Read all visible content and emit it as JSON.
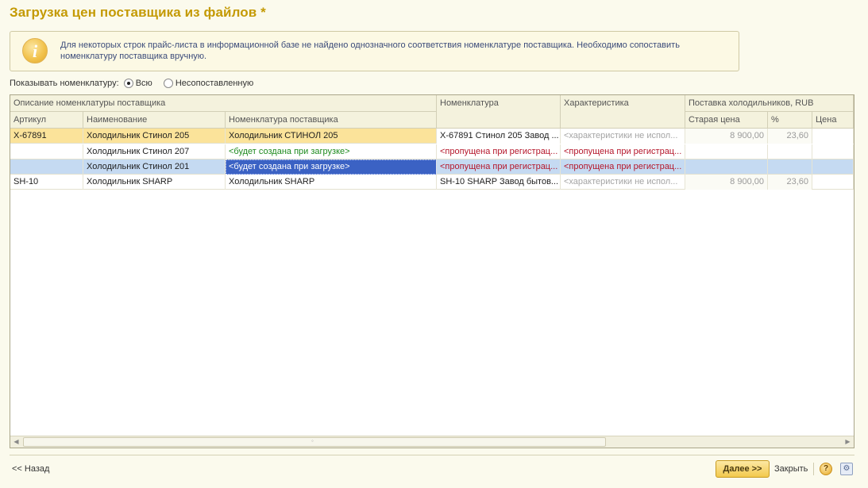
{
  "window": {
    "title": "Загрузка цен поставщика из файлов *"
  },
  "info": {
    "text": "Для некоторых строк прайс-листа в информационной базе не найдено однозначного соответствия номенклатуре поставщика. Необходимо сопоставить номенклатуру поставщика вручную."
  },
  "filter": {
    "label": "Показывать номенклатуру:",
    "options": [
      {
        "label": "Всю",
        "selected": true
      },
      {
        "label": "Несопоставленную",
        "selected": false
      }
    ]
  },
  "table": {
    "group_headers": {
      "supplier_desc": "Описание номенклатуры поставщика",
      "nomenclature": "Номенклатура",
      "characteristic": "Характеристика",
      "supply": "Поставка холодильников, RUB"
    },
    "headers": {
      "article": "Артикул",
      "name": "Наименование",
      "supplier_nom": "Номенклатура поставщика",
      "old_price": "Старая цена",
      "percent": "%",
      "price": "Цена"
    },
    "rows": [
      {
        "article": "X-67891",
        "name": "Холодильник Стинол 205",
        "supplier_nom": "Холодильник СТИНОЛ 205",
        "nomenclature": "X-67891 Стинол 205 Завод ...",
        "characteristic": "<характеристики не испол...",
        "old_price": "8 900,00",
        "percent": "23,60",
        "price": ""
      },
      {
        "article": "",
        "name": "Холодильник Стинол 207",
        "supplier_nom": "<будет создана при загрузке>",
        "nomenclature": "<пропущена при регистрац...",
        "characteristic": "<пропущена при регистрац...",
        "old_price": "",
        "percent": "",
        "price": ""
      },
      {
        "article": "",
        "name": "Холодильник Стинол 201",
        "supplier_nom": "<будет создана при загрузке>",
        "nomenclature": "<пропущена при регистрац...",
        "characteristic": "<пропущена при регистрац...",
        "old_price": "",
        "percent": "",
        "price": ""
      },
      {
        "article": "SH-10",
        "name": "Холодильник SHARP",
        "supplier_nom": "Холодильник SHARP",
        "nomenclature": "SH-10 SHARP Завод бытов...",
        "characteristic": "<характеристики не испол...",
        "old_price": "8 900,00",
        "percent": "23,60",
        "price": ""
      }
    ]
  },
  "footer": {
    "back_label": "<< Назад",
    "next_label": "Далее >>",
    "close_label": "Закрыть",
    "help_label": "?",
    "settings_label": "⚙"
  },
  "colors": {
    "title": "#c49a04",
    "selected_row": "#c5daf2",
    "focus_cell": "#3b62c4",
    "highlight_row": "#fbe39a",
    "green_text": "#1d8a1d",
    "red_text": "#b5172b"
  }
}
